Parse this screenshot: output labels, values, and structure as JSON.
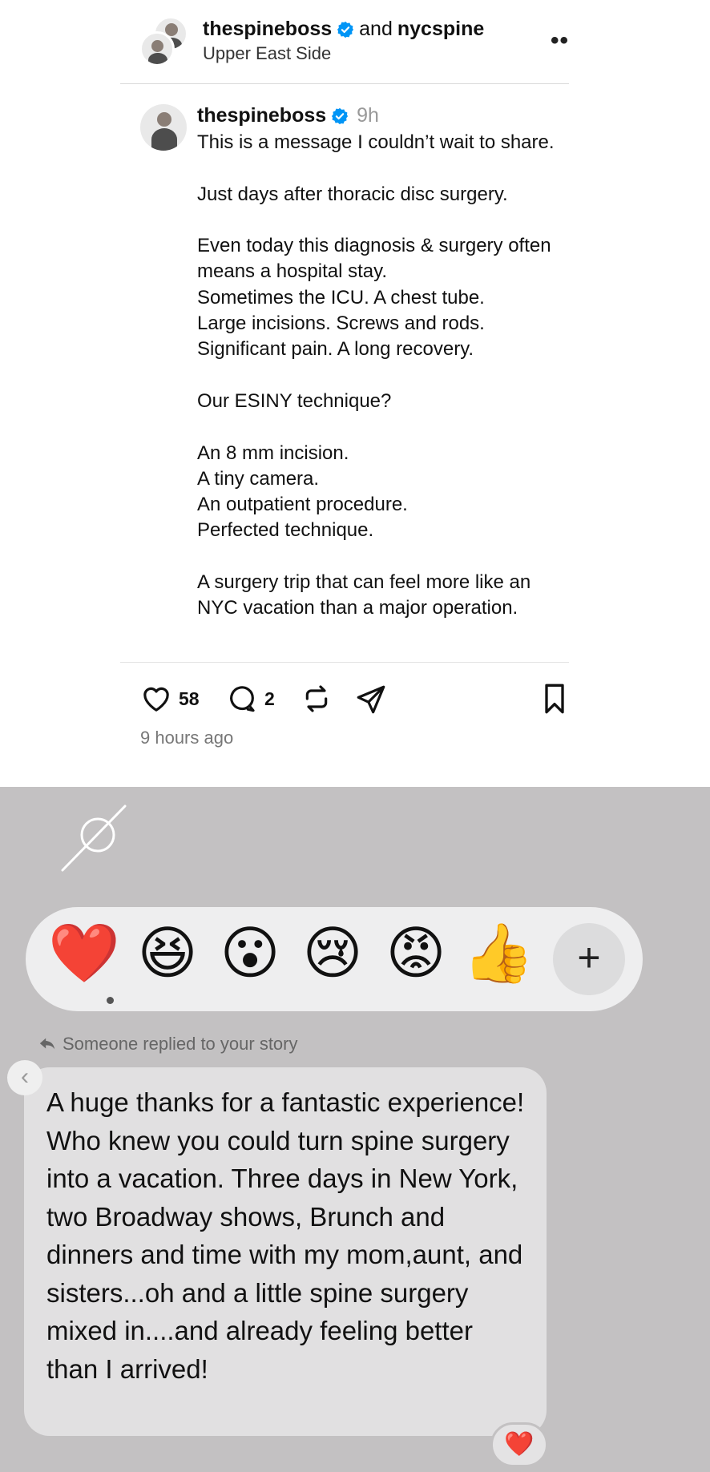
{
  "post": {
    "header": {
      "author_primary": "thespineboss",
      "connector": "and",
      "author_secondary": "nycspine",
      "location": "Upper East Side",
      "more_label": "••"
    },
    "author": "thespineboss",
    "time_short": "9h",
    "paragraphs": [
      "This is a message I couldn’t wait to share.",
      "",
      "Just days after thoracic disc surgery.",
      "",
      "Even today this diagnosis & surgery often means a hospital stay.",
      "Sometimes the ICU. A chest tube.",
      "Large incisions. Screws and rods.",
      "Significant pain. A long recovery.",
      "",
      "Our ESINY technique?",
      "",
      "An 8 mm incision.",
      "A tiny camera.",
      "An outpatient procedure.",
      "Perfected technique.",
      "",
      "A surgery trip that can feel more like an NYC vacation than a major operation."
    ],
    "actions": {
      "likes": "58",
      "comments": "2"
    },
    "timestamp": "9 hours ago",
    "icons": {
      "verified": "verified-badge-icon",
      "like": "heart-icon",
      "comment": "comment-bubble-icon",
      "repost": "repost-icon",
      "share": "send-icon",
      "save": "bookmark-icon"
    },
    "accent_color": "#0095f6"
  },
  "reactions": {
    "items": [
      {
        "name": "heart",
        "glyph": "❤️"
      },
      {
        "name": "laughing",
        "glyph": "😆"
      },
      {
        "name": "surprised",
        "glyph": "😮"
      },
      {
        "name": "crying",
        "glyph": "😢"
      },
      {
        "name": "angry",
        "glyph": "😡"
      },
      {
        "name": "thumbs-up",
        "glyph": "👍"
      }
    ],
    "more_label": "+"
  },
  "reply": {
    "label": "Someone replied to your story",
    "message": "A huge thanks for a fantastic experience! Who knew you could turn spine surgery into a vacation. Three days in New York, two Broadway shows, Brunch and dinners and time with my mom,aunt, and sisters...oh and a little spine surgery mixed in....and already feeling better than I arrived!",
    "back_label": "‹",
    "reaction_glyph": "❤️"
  }
}
